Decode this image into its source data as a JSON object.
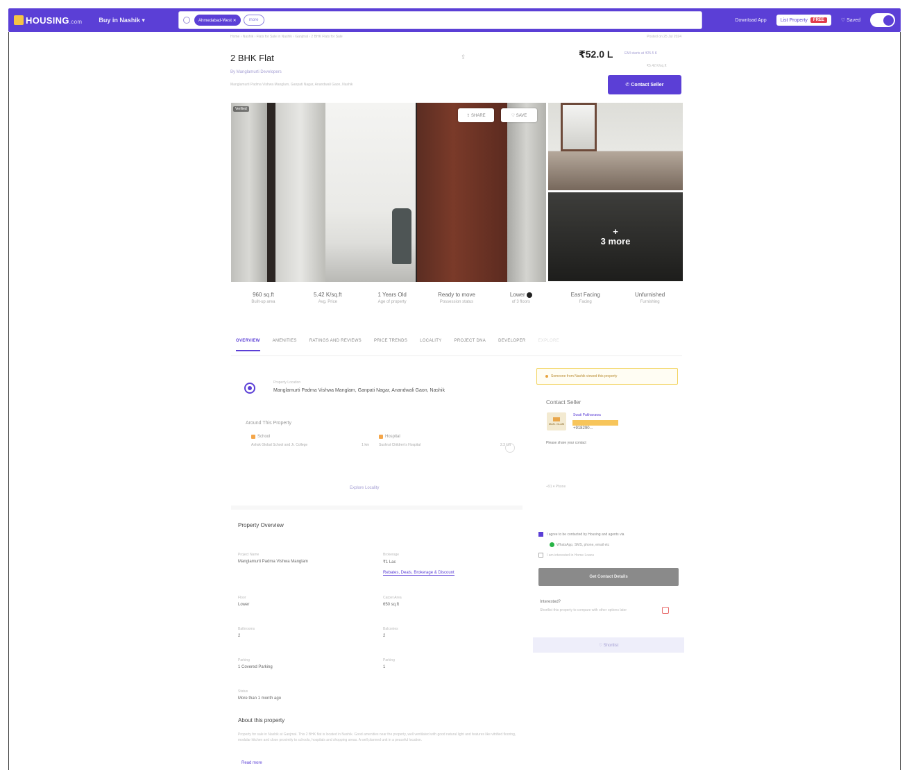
{
  "nav": {
    "logo_main": "HOUSING",
    "logo_suffix": ".com",
    "city": "Buy in Nashik ▾",
    "search_chip": "Ahmedabad-West ✕",
    "search_more": "more",
    "download_app": "Download App",
    "post_property": "List Property",
    "free_badge": "FREE",
    "saved": "♡ Saved"
  },
  "breadcrumb": "Home › Nashik › Flats for Sale in Nashik › Ganjmal › 2 BHK Flats for Sale",
  "posted_on": "Posted on 25 Jul 2024",
  "title": "2 BHK Flat",
  "price": "₹52.0 L",
  "emi": "EMI starts at ₹25.5 K",
  "price_per_sqft": "₹5.42 K/sq.ft",
  "developer_link": "By Manglamurti Developers",
  "address_line": "Manglamurti Padma Vishwa Manglam, Ganpati Nagar, Anandwali Gaon, Nashik",
  "contact_button": "✆ Contact Seller",
  "gallery": {
    "tag": "Verified",
    "share": "⇪ SHARE",
    "save": "♡ SAVE",
    "more_count": "3 more",
    "more_plus": "+"
  },
  "stats": [
    {
      "value": "960 sq.ft",
      "label": "Built-up area"
    },
    {
      "value": "5.42 K/sq.ft",
      "label": "Avg. Price"
    },
    {
      "value": "1 Years Old",
      "label": "Age of property"
    },
    {
      "value": "Ready to move",
      "label": "Possession status"
    },
    {
      "value": "Lower",
      "label": "of 3 floors"
    },
    {
      "value": "East Facing",
      "label": "Facing"
    },
    {
      "value": "Unfurnished",
      "label": "Furnishing"
    }
  ],
  "tabs": [
    "OVERVIEW",
    "AMENITIES",
    "RATINGS AND REVIEWS",
    "PRICE TRENDS",
    "LOCALITY",
    "PROJECT DNA",
    "DEVELOPER",
    "EXPLORE"
  ],
  "location": {
    "label": "Property Location",
    "text": "Manglamurti Padma Vishwa Manglam, Ganpati Nagar, Anandwali Gaon, Nashik"
  },
  "around": {
    "title": "Around This Property",
    "school_head": "School",
    "school_name": "Ashok Global School and Jr. College",
    "school_dist": "1 km",
    "hospital_head": "Hospital",
    "hospital_name": "Sushrut Children's Hospital",
    "hospital_dist": "2.3 km",
    "explore_link": "Explore Locality"
  },
  "overview": {
    "title": "Property Overview",
    "items": [
      {
        "label": "Project Name",
        "value": "Manglamurti Padma Vishwa Manglam"
      },
      {
        "label": "Brokerage",
        "value": "₹1 Lac",
        "link": "Rebates, Deals, Brokerage & Discount"
      },
      {
        "label": "Floor",
        "value": "Lower"
      },
      {
        "label": "Carpet Area",
        "value": "650 sq.ft"
      },
      {
        "label": "Bathrooms",
        "value": "2"
      },
      {
        "label": "Balconies",
        "value": "2"
      },
      {
        "label": "Parking",
        "value": "1 Covered Parking"
      },
      {
        "label": "Parking",
        "value": "1"
      },
      {
        "label": "Status",
        "value": "More than 1 month ago"
      }
    ]
  },
  "about": {
    "title": "About this property",
    "text": "Property for sale in Nashik at Ganjmal. This 2 BHK flat is located in Nashik. Good amenities near the property, well ventilated with good natural light and features like vitrified flooring, modular kitchen and close proximity to schools, hospitals and shopping areas. A well planned unit in a peaceful location.",
    "read_more": "Read more"
  },
  "sidebar": {
    "alert": "Someone from Nashik viewed this property",
    "contact_title": "Contact Seller",
    "seller_logo_text": "MAN. GLAM",
    "seller_name": "Swati Pakhanawa",
    "seller_phone": "+918290...",
    "details_note": "Please share your contact",
    "form_field": "+91 ▾  Phone",
    "consent": "I agree to be contacted by Housing and agents via",
    "whatsapp": "WhatsApp, SMS, phone, email etc",
    "consent2": "I am interested in Home Loans",
    "get_button": "Get Contact Details",
    "interested_title": "Interested?",
    "interested_sub": "Shortlist this property to compare with other options later",
    "feedback": "♡ Shortlist"
  }
}
